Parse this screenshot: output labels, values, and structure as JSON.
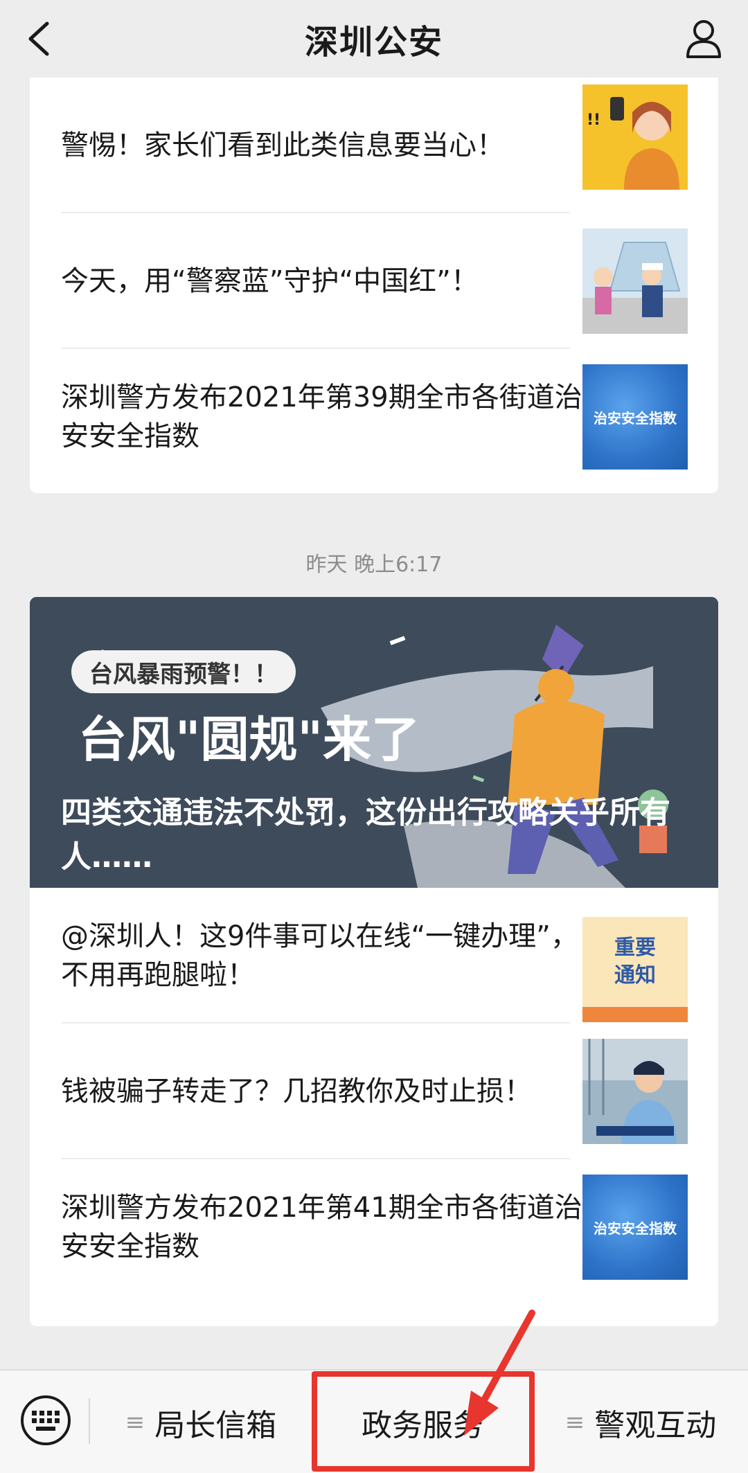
{
  "header": {
    "title": "深圳公安"
  },
  "card1": {
    "items": [
      {
        "text": "警惕！家长们看到此类信息要当心！",
        "thumb": "alarmed-woman-phone"
      },
      {
        "text": "今天，用“警察蓝”守护“中国红”！",
        "thumb": "police-cartoon"
      },
      {
        "text": "深圳警方发布2021年第39期全市各街道治安安全指数",
        "thumb": "safety-index",
        "thumb_label": "治安安全指数"
      }
    ]
  },
  "timestamp": "昨天 晚上6:17",
  "card2": {
    "banner": {
      "badge": "台风暴雨预警！！",
      "title": "台风\"圆规\"来了",
      "caption": "四类交通违法不处罚，这份出行攻略关乎所有人……"
    },
    "items": [
      {
        "text": "@深圳人！这9件事可以在线“一键办理”，不用再跑腿啦！",
        "thumb": "notice",
        "thumb_line1": "重要",
        "thumb_line2": "通知"
      },
      {
        "text": "钱被骗子转走了？几招教你及时止损！",
        "thumb": "police-officer-photo"
      },
      {
        "text": "深圳警方发布2021年第41期全市各街道治安安全指数",
        "thumb": "safety-index",
        "thumb_label": "治安安全指数"
      }
    ]
  },
  "bottom_menu": {
    "items": [
      {
        "label": "局长信箱",
        "has_submenu": true
      },
      {
        "label": "政务服务",
        "has_submenu": false
      },
      {
        "label": "警观互动",
        "has_submenu": true
      }
    ],
    "highlight_color": "#e8352d"
  },
  "icons": {
    "back": "chevron-left-icon",
    "profile": "person-icon",
    "keyboard": "keyboard-icon",
    "submenu": "hamburger-icon"
  }
}
